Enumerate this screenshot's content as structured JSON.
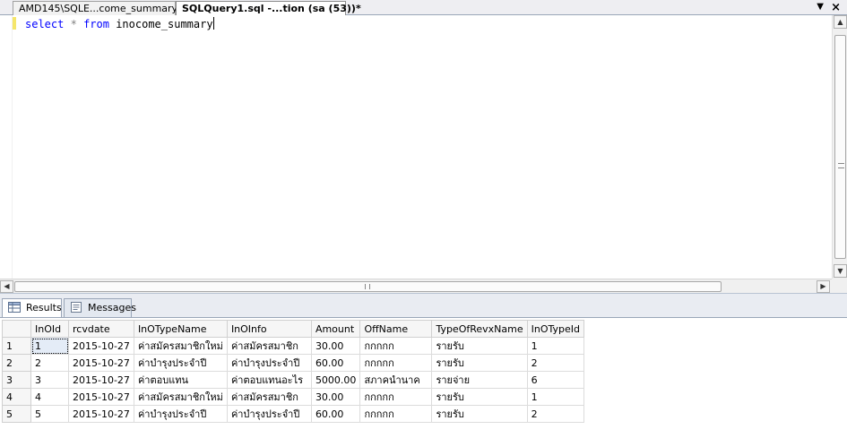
{
  "tabs": {
    "inactive_label": "AMD145\\SQLE...come_summary",
    "active_label": "SQLQuery1.sql -...tion (sa (53))*"
  },
  "editor": {
    "keyword_select": "select",
    "operator_star": "*",
    "keyword_from": "from",
    "table_name": "inocome_summary"
  },
  "results_tabs": {
    "results_label": "Results",
    "messages_label": "Messages"
  },
  "grid": {
    "columns": [
      "InOId",
      "rcvdate",
      "InOTypeName",
      "InOInfo",
      "Amount",
      "OffName",
      "TypeOfRevxName",
      "InOTypeId"
    ],
    "rows": [
      {
        "num": "1",
        "cells": [
          "1",
          "2015-10-27",
          "ค่าสมัครสมาชิกใหม่",
          "ค่าสมัครสมาชิก",
          "30.00",
          "กกกกก",
          "รายรับ",
          "1"
        ]
      },
      {
        "num": "2",
        "cells": [
          "2",
          "2015-10-27",
          "ค่าบำรุงประจำปี",
          "ค่าบำรุงประจำปี",
          "60.00",
          "กกกกก",
          "รายรับ",
          "2"
        ]
      },
      {
        "num": "3",
        "cells": [
          "3",
          "2015-10-27",
          "ค่าตอบแทน",
          "ค่าตอบแทนอะไร",
          "5000.00",
          "สภาคนำนาค",
          "รายจ่าย",
          "6"
        ]
      },
      {
        "num": "4",
        "cells": [
          "4",
          "2015-10-27",
          "ค่าสมัครสมาชิกใหม่",
          "ค่าสมัครสมาชิก",
          "30.00",
          "กกกกก",
          "รายรับ",
          "1"
        ]
      },
      {
        "num": "5",
        "cells": [
          "5",
          "2015-10-27",
          "ค่าบำรุงประจำปี",
          "ค่าบำรุงประจำปี",
          "60.00",
          "กกกกก",
          "รายรับ",
          "2"
        ]
      }
    ]
  }
}
